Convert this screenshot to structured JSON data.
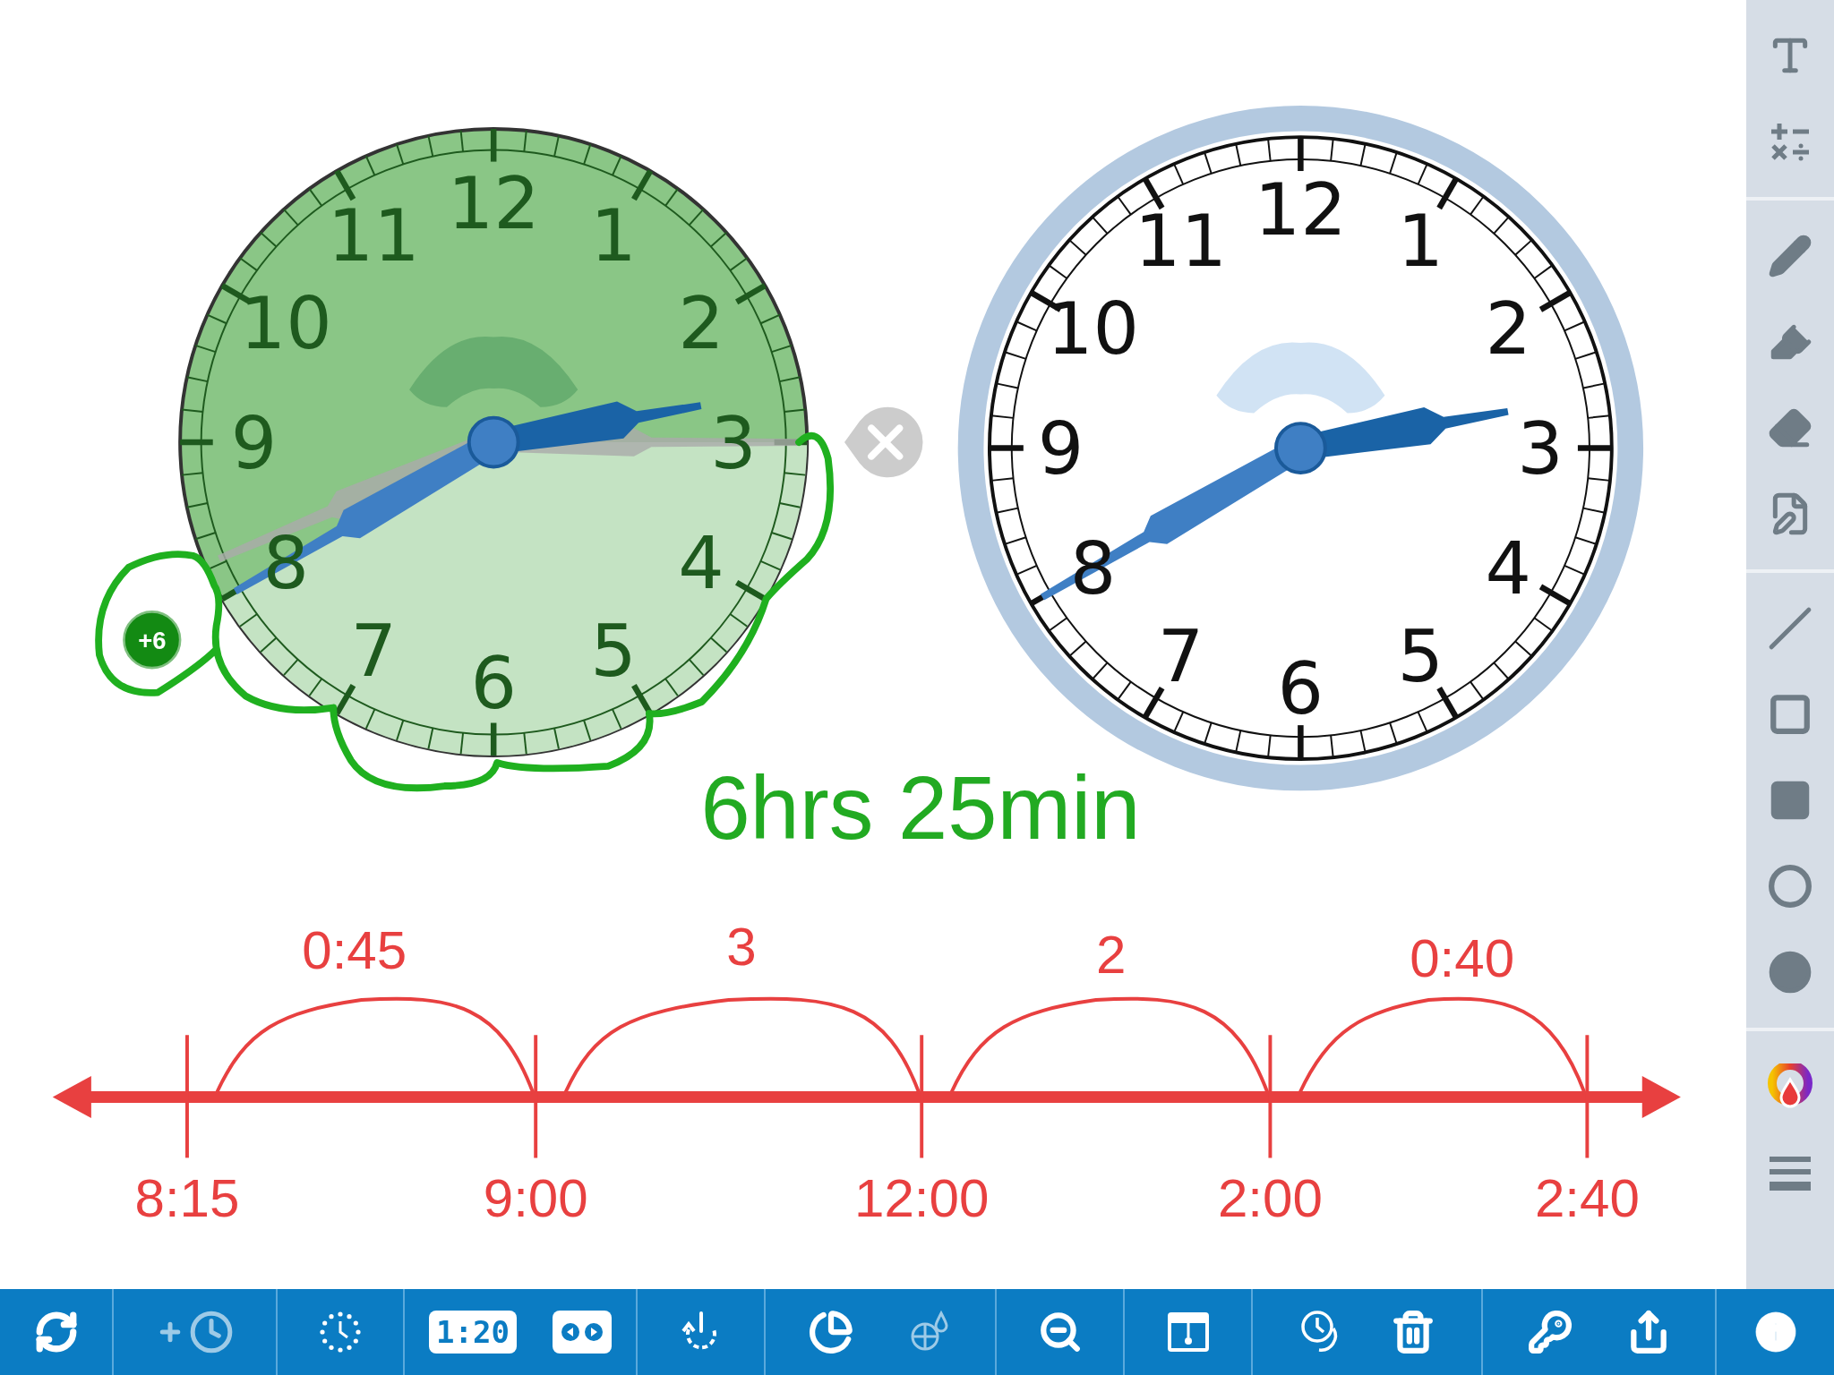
{
  "canvas": {
    "elapsed_clock": {
      "numbers": [
        "12",
        "11",
        "1",
        "10",
        "2",
        "9",
        "3",
        "8",
        "4",
        "7",
        "5",
        "6"
      ],
      "badge": "+6"
    },
    "clock": {
      "numbers": [
        "12",
        "11",
        "1",
        "10",
        "2",
        "9",
        "3",
        "8",
        "4",
        "7",
        "5",
        "6"
      ]
    },
    "duration": "6hrs 25min",
    "number_line": {
      "jumps": [
        "0:45",
        "3",
        "2",
        "0:40"
      ],
      "ticks": [
        "8:15",
        "9:00",
        "12:00",
        "2:00",
        "2:40"
      ]
    }
  },
  "toolbar": {
    "digital_display": "1:20"
  }
}
